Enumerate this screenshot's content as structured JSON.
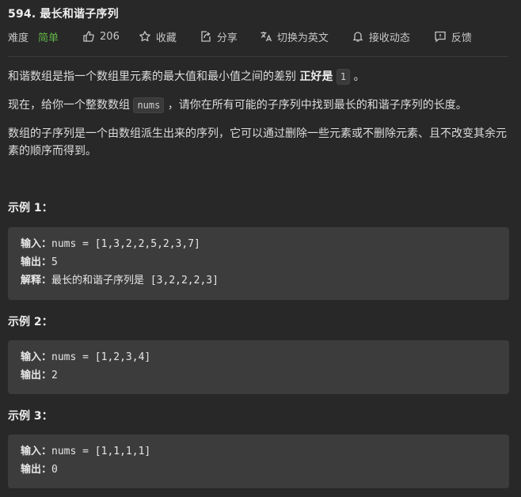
{
  "problem": {
    "title": "594. 最长和谐子序列"
  },
  "toolbar": {
    "difficulty_label": "难度",
    "difficulty_value": "简单",
    "likes": "206",
    "favorite_label": "收藏",
    "share_label": "分享",
    "translate_label": "切换为英文",
    "subscribe_label": "接收动态",
    "feedback_label": "反馈"
  },
  "description": {
    "p1_prefix": "和谐数组是指一个数组里元素的最大值和最小值之间的差别 ",
    "p1_bold": "正好是",
    "p1_code": "1",
    "p1_suffix": " 。",
    "p2_prefix": "现在，给你一个整数数组 ",
    "p2_code": "nums",
    "p2_suffix": " ，请你在所有可能的子序列中找到最长的和谐子序列的长度。",
    "p3": "数组的子序列是一个由数组派生出来的序列，它可以通过删除一些元素或不删除元素、且不改变其余元素的顺序而得到。"
  },
  "examples": [
    {
      "title": "示例 1：",
      "input_key": "输入：",
      "input_value": "nums = [1,3,2,2,5,2,3,7]",
      "output_key": "输出：",
      "output_value": "5",
      "explain_key": "解释：",
      "explain_value": "最长的和谐子序列是 [3,2,2,2,3]"
    },
    {
      "title": "示例 2：",
      "input_key": "输入：",
      "input_value": "nums = [1,2,3,4]",
      "output_key": "输出：",
      "output_value": "2"
    },
    {
      "title": "示例 3：",
      "input_key": "输入：",
      "input_value": "nums = [1,1,1,1]",
      "output_key": "输出：",
      "output_value": "0"
    }
  ],
  "colors": {
    "background": "#282828",
    "difficulty_easy": "#62b348",
    "code_block_bg": "#3c3c3c"
  }
}
